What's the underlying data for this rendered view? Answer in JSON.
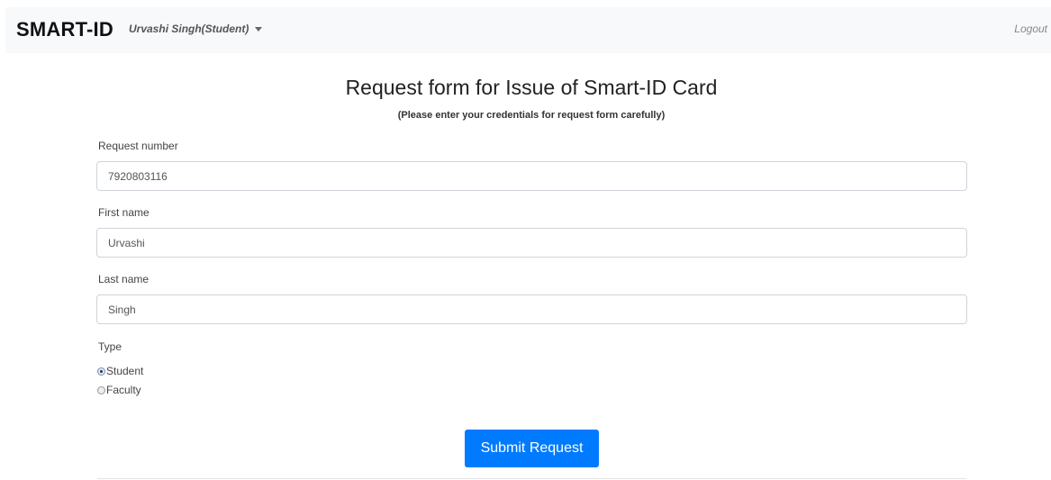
{
  "navbar": {
    "brand": "SMART-ID",
    "user": "Urvashi Singh(Student)",
    "logout": "Logout"
  },
  "form": {
    "title": "Request form for Issue of Smart-ID Card",
    "subtitle": "(Please enter your credentials for request form carefully)",
    "request_number": {
      "label": "Request number",
      "value": "7920803116"
    },
    "first_name": {
      "label": "First name",
      "value": "Urvashi"
    },
    "last_name": {
      "label": "Last name",
      "value": "Singh"
    },
    "type": {
      "label": "Type",
      "options": [
        {
          "label": "Student",
          "selected": true
        },
        {
          "label": "Faculty",
          "selected": false
        }
      ]
    },
    "submit_label": "Submit Request"
  },
  "colors": {
    "primary": "#007bff",
    "navbar_bg": "#f8f9fa"
  }
}
